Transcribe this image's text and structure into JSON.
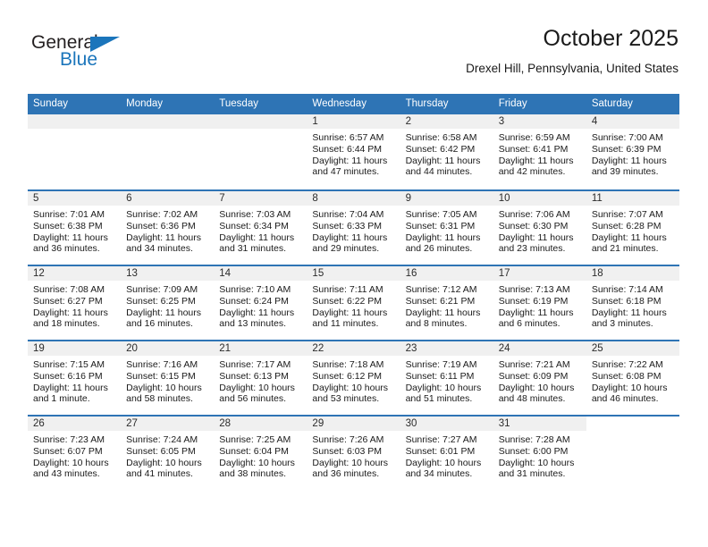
{
  "brand": {
    "logo_text_primary": "General",
    "logo_text_secondary": "Blue",
    "primary_color": "#231f20",
    "accent_color": "#1b75bb"
  },
  "header": {
    "title": "October 2025",
    "subtitle": "Drexel Hill, Pennsylvania, United States",
    "header_bg_color": "#2e74b5",
    "daynum_band_color": "#f0f0f0"
  },
  "weekday_headers": [
    "Sunday",
    "Monday",
    "Tuesday",
    "Wednesday",
    "Thursday",
    "Friday",
    "Saturday"
  ],
  "weeks": [
    [
      {
        "day": "",
        "sunrise": "",
        "sunset": "",
        "daylight1": "",
        "daylight2": "",
        "state": "empty"
      },
      {
        "day": "",
        "sunrise": "",
        "sunset": "",
        "daylight1": "",
        "daylight2": "",
        "state": "empty"
      },
      {
        "day": "",
        "sunrise": "",
        "sunset": "",
        "daylight1": "",
        "daylight2": "",
        "state": "empty"
      },
      {
        "day": "1",
        "sunrise": "Sunrise: 6:57 AM",
        "sunset": "Sunset: 6:44 PM",
        "daylight1": "Daylight: 11 hours",
        "daylight2": "and 47 minutes.",
        "state": "day"
      },
      {
        "day": "2",
        "sunrise": "Sunrise: 6:58 AM",
        "sunset": "Sunset: 6:42 PM",
        "daylight1": "Daylight: 11 hours",
        "daylight2": "and 44 minutes.",
        "state": "day"
      },
      {
        "day": "3",
        "sunrise": "Sunrise: 6:59 AM",
        "sunset": "Sunset: 6:41 PM",
        "daylight1": "Daylight: 11 hours",
        "daylight2": "and 42 minutes.",
        "state": "day"
      },
      {
        "day": "4",
        "sunrise": "Sunrise: 7:00 AM",
        "sunset": "Sunset: 6:39 PM",
        "daylight1": "Daylight: 11 hours",
        "daylight2": "and 39 minutes.",
        "state": "day"
      }
    ],
    [
      {
        "day": "5",
        "sunrise": "Sunrise: 7:01 AM",
        "sunset": "Sunset: 6:38 PM",
        "daylight1": "Daylight: 11 hours",
        "daylight2": "and 36 minutes.",
        "state": "day"
      },
      {
        "day": "6",
        "sunrise": "Sunrise: 7:02 AM",
        "sunset": "Sunset: 6:36 PM",
        "daylight1": "Daylight: 11 hours",
        "daylight2": "and 34 minutes.",
        "state": "day"
      },
      {
        "day": "7",
        "sunrise": "Sunrise: 7:03 AM",
        "sunset": "Sunset: 6:34 PM",
        "daylight1": "Daylight: 11 hours",
        "daylight2": "and 31 minutes.",
        "state": "day"
      },
      {
        "day": "8",
        "sunrise": "Sunrise: 7:04 AM",
        "sunset": "Sunset: 6:33 PM",
        "daylight1": "Daylight: 11 hours",
        "daylight2": "and 29 minutes.",
        "state": "day"
      },
      {
        "day": "9",
        "sunrise": "Sunrise: 7:05 AM",
        "sunset": "Sunset: 6:31 PM",
        "daylight1": "Daylight: 11 hours",
        "daylight2": "and 26 minutes.",
        "state": "day"
      },
      {
        "day": "10",
        "sunrise": "Sunrise: 7:06 AM",
        "sunset": "Sunset: 6:30 PM",
        "daylight1": "Daylight: 11 hours",
        "daylight2": "and 23 minutes.",
        "state": "day"
      },
      {
        "day": "11",
        "sunrise": "Sunrise: 7:07 AM",
        "sunset": "Sunset: 6:28 PM",
        "daylight1": "Daylight: 11 hours",
        "daylight2": "and 21 minutes.",
        "state": "day"
      }
    ],
    [
      {
        "day": "12",
        "sunrise": "Sunrise: 7:08 AM",
        "sunset": "Sunset: 6:27 PM",
        "daylight1": "Daylight: 11 hours",
        "daylight2": "and 18 minutes.",
        "state": "day"
      },
      {
        "day": "13",
        "sunrise": "Sunrise: 7:09 AM",
        "sunset": "Sunset: 6:25 PM",
        "daylight1": "Daylight: 11 hours",
        "daylight2": "and 16 minutes.",
        "state": "day"
      },
      {
        "day": "14",
        "sunrise": "Sunrise: 7:10 AM",
        "sunset": "Sunset: 6:24 PM",
        "daylight1": "Daylight: 11 hours",
        "daylight2": "and 13 minutes.",
        "state": "day"
      },
      {
        "day": "15",
        "sunrise": "Sunrise: 7:11 AM",
        "sunset": "Sunset: 6:22 PM",
        "daylight1": "Daylight: 11 hours",
        "daylight2": "and 11 minutes.",
        "state": "day"
      },
      {
        "day": "16",
        "sunrise": "Sunrise: 7:12 AM",
        "sunset": "Sunset: 6:21 PM",
        "daylight1": "Daylight: 11 hours",
        "daylight2": "and 8 minutes.",
        "state": "day"
      },
      {
        "day": "17",
        "sunrise": "Sunrise: 7:13 AM",
        "sunset": "Sunset: 6:19 PM",
        "daylight1": "Daylight: 11 hours",
        "daylight2": "and 6 minutes.",
        "state": "day"
      },
      {
        "day": "18",
        "sunrise": "Sunrise: 7:14 AM",
        "sunset": "Sunset: 6:18 PM",
        "daylight1": "Daylight: 11 hours",
        "daylight2": "and 3 minutes.",
        "state": "day"
      }
    ],
    [
      {
        "day": "19",
        "sunrise": "Sunrise: 7:15 AM",
        "sunset": "Sunset: 6:16 PM",
        "daylight1": "Daylight: 11 hours",
        "daylight2": "and 1 minute.",
        "state": "day"
      },
      {
        "day": "20",
        "sunrise": "Sunrise: 7:16 AM",
        "sunset": "Sunset: 6:15 PM",
        "daylight1": "Daylight: 10 hours",
        "daylight2": "and 58 minutes.",
        "state": "day"
      },
      {
        "day": "21",
        "sunrise": "Sunrise: 7:17 AM",
        "sunset": "Sunset: 6:13 PM",
        "daylight1": "Daylight: 10 hours",
        "daylight2": "and 56 minutes.",
        "state": "day"
      },
      {
        "day": "22",
        "sunrise": "Sunrise: 7:18 AM",
        "sunset": "Sunset: 6:12 PM",
        "daylight1": "Daylight: 10 hours",
        "daylight2": "and 53 minutes.",
        "state": "day"
      },
      {
        "day": "23",
        "sunrise": "Sunrise: 7:19 AM",
        "sunset": "Sunset: 6:11 PM",
        "daylight1": "Daylight: 10 hours",
        "daylight2": "and 51 minutes.",
        "state": "day"
      },
      {
        "day": "24",
        "sunrise": "Sunrise: 7:21 AM",
        "sunset": "Sunset: 6:09 PM",
        "daylight1": "Daylight: 10 hours",
        "daylight2": "and 48 minutes.",
        "state": "day"
      },
      {
        "day": "25",
        "sunrise": "Sunrise: 7:22 AM",
        "sunset": "Sunset: 6:08 PM",
        "daylight1": "Daylight: 10 hours",
        "daylight2": "and 46 minutes.",
        "state": "day"
      }
    ],
    [
      {
        "day": "26",
        "sunrise": "Sunrise: 7:23 AM",
        "sunset": "Sunset: 6:07 PM",
        "daylight1": "Daylight: 10 hours",
        "daylight2": "and 43 minutes.",
        "state": "day"
      },
      {
        "day": "27",
        "sunrise": "Sunrise: 7:24 AM",
        "sunset": "Sunset: 6:05 PM",
        "daylight1": "Daylight: 10 hours",
        "daylight2": "and 41 minutes.",
        "state": "day"
      },
      {
        "day": "28",
        "sunrise": "Sunrise: 7:25 AM",
        "sunset": "Sunset: 6:04 PM",
        "daylight1": "Daylight: 10 hours",
        "daylight2": "and 38 minutes.",
        "state": "day"
      },
      {
        "day": "29",
        "sunrise": "Sunrise: 7:26 AM",
        "sunset": "Sunset: 6:03 PM",
        "daylight1": "Daylight: 10 hours",
        "daylight2": "and 36 minutes.",
        "state": "day"
      },
      {
        "day": "30",
        "sunrise": "Sunrise: 7:27 AM",
        "sunset": "Sunset: 6:01 PM",
        "daylight1": "Daylight: 10 hours",
        "daylight2": "and 34 minutes.",
        "state": "day"
      },
      {
        "day": "31",
        "sunrise": "Sunrise: 7:28 AM",
        "sunset": "Sunset: 6:00 PM",
        "daylight1": "Daylight: 10 hours",
        "daylight2": "and 31 minutes.",
        "state": "day"
      },
      {
        "day": "",
        "sunrise": "",
        "sunset": "",
        "daylight1": "",
        "daylight2": "",
        "state": "blank"
      }
    ]
  ]
}
